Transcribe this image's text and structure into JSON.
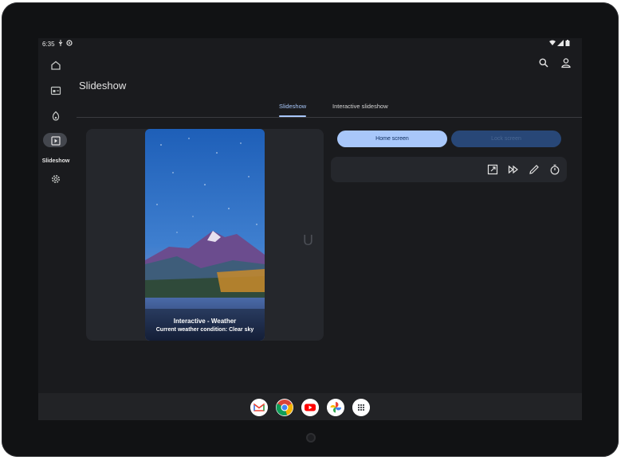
{
  "status": {
    "time": "6:35"
  },
  "rail": {
    "items": [
      {
        "icon": "home-icon"
      },
      {
        "icon": "wallpaper-icon"
      },
      {
        "icon": "palette-icon"
      },
      {
        "icon": "slideshow-icon",
        "label": "Slideshow",
        "active": true
      },
      {
        "icon": "gear-icon"
      }
    ]
  },
  "header": {
    "title": "Slideshow"
  },
  "tabs": [
    {
      "label": "Slideshow",
      "active": true
    },
    {
      "label": "Interactive slideshow",
      "active": false
    }
  ],
  "preview": {
    "title": "Interactive - Weather",
    "subtitle": "Current weather condition: Clear sky",
    "ghost_text": "U"
  },
  "segments": {
    "home_label": "Home screen",
    "lock_label": "Lock screen"
  },
  "actions": [
    "open-external-icon",
    "fast-forward-icon",
    "edit-pencil-icon",
    "timer-icon"
  ],
  "dock": [
    "gmail-icon",
    "chrome-icon",
    "youtube-icon",
    "photos-icon",
    "app-drawer-icon"
  ],
  "colors": {
    "accent": "#a8c7fa",
    "background": "#1a1b1e",
    "card": "#25272c",
    "lock_button": "#284777"
  }
}
